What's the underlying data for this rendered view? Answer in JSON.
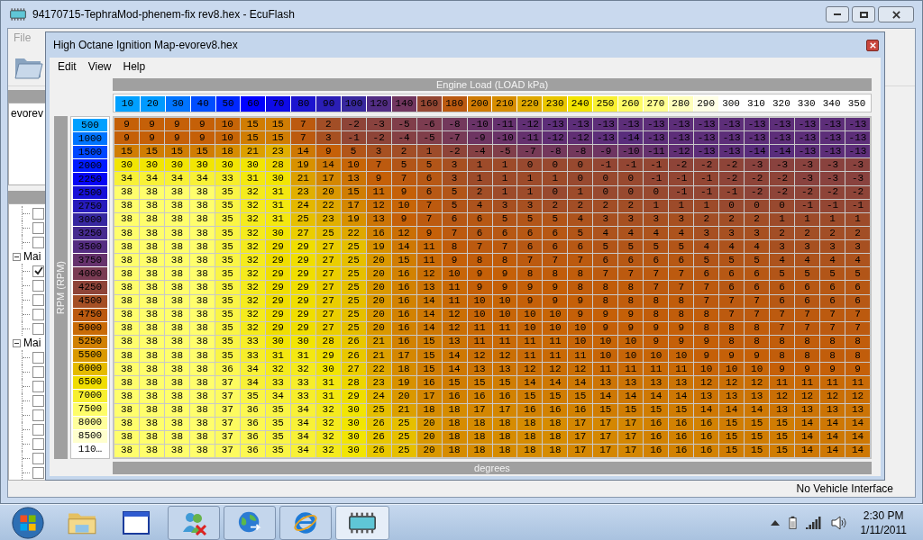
{
  "app_window": {
    "title": "94170715-TephraMod-phenem-fix rev8.hex - EcuFlash",
    "menu": [
      "File"
    ],
    "file_list": [
      "evorev"
    ],
    "tree": {
      "items": [
        {
          "checked": false
        },
        {
          "checked": false
        },
        {
          "checked": false
        }
      ],
      "groups": [
        {
          "label": "Mai",
          "expanded": true,
          "children": [
            {
              "checked": true
            },
            {
              "checked": false
            },
            {
              "checked": false
            },
            {
              "checked": false
            },
            {
              "checked": false
            }
          ]
        },
        {
          "label": "Mai",
          "expanded": true,
          "children": [
            {
              "checked": false
            },
            {
              "checked": false
            },
            {
              "checked": false
            },
            {
              "checked": false
            },
            {
              "checked": false
            },
            {
              "checked": false
            },
            {
              "checked": false
            },
            {
              "checked": false
            },
            {
              "checked": false
            }
          ]
        }
      ]
    },
    "status": "No Vehicle Interface"
  },
  "map_window": {
    "title": "High Octane Ignition Map-evorev8.hex",
    "menu": [
      "Edit",
      "View",
      "Help"
    ],
    "x_axis": {
      "title": "Engine Load (LOAD kPa)",
      "values": [
        "10",
        "20",
        "30",
        "40",
        "50",
        "60",
        "70",
        "80",
        "90",
        "100",
        "120",
        "140",
        "160",
        "180",
        "200",
        "210",
        "220",
        "230",
        "240",
        "250",
        "260",
        "270",
        "280",
        "290",
        "300",
        "310",
        "320",
        "330",
        "340",
        "350"
      ]
    },
    "y_axis": {
      "title": "RPM (RPM)",
      "values": [
        "500",
        "1000",
        "1500",
        "2000",
        "2250",
        "2500",
        "2750",
        "3000",
        "3250",
        "3500",
        "3750",
        "4000",
        "4250",
        "4500",
        "4750",
        "5000",
        "5250",
        "5500",
        "6000",
        "6500",
        "7000",
        "7500",
        "8000",
        "8500",
        "110…"
      ]
    },
    "rows": [
      [
        "9",
        "9",
        "9",
        "9",
        "10",
        "15",
        "15",
        "7",
        "2",
        "-2",
        "-3",
        "-5",
        "-6",
        "-8",
        "-10",
        "-11",
        "-12",
        "-13",
        "-13",
        "-13",
        "-13",
        "-13",
        "-13",
        "-13",
        "-13",
        "-13",
        "-13",
        "-13",
        "-13",
        "-13"
      ],
      [
        "9",
        "9",
        "9",
        "9",
        "10",
        "15",
        "15",
        "7",
        "3",
        "-1",
        "-2",
        "-4",
        "-5",
        "-7",
        "-9",
        "-10",
        "-11",
        "-12",
        "-12",
        "-13",
        "-14",
        "-13",
        "-13",
        "-13",
        "-13",
        "-13",
        "-13",
        "-13",
        "-13",
        "-13"
      ],
      [
        "15",
        "15",
        "15",
        "15",
        "18",
        "21",
        "23",
        "14",
        "9",
        "5",
        "3",
        "2",
        "1",
        "-2",
        "-4",
        "-5",
        "-7",
        "-8",
        "-8",
        "-9",
        "-10",
        "-11",
        "-12",
        "-13",
        "-13",
        "-14",
        "-14",
        "-13",
        "-13",
        "-13"
      ],
      [
        "30",
        "30",
        "30",
        "30",
        "30",
        "30",
        "28",
        "19",
        "14",
        "10",
        "7",
        "5",
        "5",
        "3",
        "1",
        "1",
        "0",
        "0",
        "0",
        "-1",
        "-1",
        "-1",
        "-2",
        "-2",
        "-2",
        "-3",
        "-3",
        "-3",
        "-3",
        "-3"
      ],
      [
        "34",
        "34",
        "34",
        "34",
        "33",
        "31",
        "30",
        "21",
        "17",
        "13",
        "9",
        "7",
        "6",
        "3",
        "1",
        "1",
        "1",
        "1",
        "0",
        "0",
        "0",
        "-1",
        "-1",
        "-1",
        "-2",
        "-2",
        "-2",
        "-3",
        "-3",
        "-3"
      ],
      [
        "38",
        "38",
        "38",
        "38",
        "35",
        "32",
        "31",
        "23",
        "20",
        "15",
        "11",
        "9",
        "6",
        "5",
        "2",
        "1",
        "1",
        "0",
        "1",
        "0",
        "0",
        "0",
        "-1",
        "-1",
        "-1",
        "-2",
        "-2",
        "-2",
        "-2",
        "-2"
      ],
      [
        "38",
        "38",
        "38",
        "38",
        "35",
        "32",
        "31",
        "24",
        "22",
        "17",
        "12",
        "10",
        "7",
        "5",
        "4",
        "3",
        "3",
        "2",
        "2",
        "2",
        "2",
        "1",
        "1",
        "1",
        "0",
        "0",
        "0",
        "-1",
        "-1",
        "-1"
      ],
      [
        "38",
        "38",
        "38",
        "38",
        "35",
        "32",
        "31",
        "25",
        "23",
        "19",
        "13",
        "9",
        "7",
        "6",
        "6",
        "5",
        "5",
        "5",
        "4",
        "3",
        "3",
        "3",
        "3",
        "2",
        "2",
        "2",
        "1",
        "1",
        "1",
        "1"
      ],
      [
        "38",
        "38",
        "38",
        "38",
        "35",
        "32",
        "30",
        "27",
        "25",
        "22",
        "16",
        "12",
        "9",
        "7",
        "6",
        "6",
        "6",
        "6",
        "5",
        "4",
        "4",
        "4",
        "4",
        "3",
        "3",
        "3",
        "2",
        "2",
        "2",
        "2"
      ],
      [
        "38",
        "38",
        "38",
        "38",
        "35",
        "32",
        "29",
        "29",
        "27",
        "25",
        "19",
        "14",
        "11",
        "8",
        "7",
        "7",
        "6",
        "6",
        "6",
        "5",
        "5",
        "5",
        "5",
        "4",
        "4",
        "4",
        "3",
        "3",
        "3",
        "3"
      ],
      [
        "38",
        "38",
        "38",
        "38",
        "35",
        "32",
        "29",
        "29",
        "27",
        "25",
        "20",
        "15",
        "11",
        "9",
        "8",
        "8",
        "7",
        "7",
        "7",
        "6",
        "6",
        "6",
        "6",
        "5",
        "5",
        "5",
        "4",
        "4",
        "4",
        "4"
      ],
      [
        "38",
        "38",
        "38",
        "38",
        "35",
        "32",
        "29",
        "29",
        "27",
        "25",
        "20",
        "16",
        "12",
        "10",
        "9",
        "9",
        "8",
        "8",
        "8",
        "7",
        "7",
        "7",
        "7",
        "6",
        "6",
        "6",
        "5",
        "5",
        "5",
        "5"
      ],
      [
        "38",
        "38",
        "38",
        "38",
        "35",
        "32",
        "29",
        "29",
        "27",
        "25",
        "20",
        "16",
        "13",
        "11",
        "9",
        "9",
        "9",
        "9",
        "8",
        "8",
        "8",
        "7",
        "7",
        "7",
        "6",
        "6",
        "6",
        "6",
        "6",
        "6"
      ],
      [
        "38",
        "38",
        "38",
        "38",
        "35",
        "32",
        "29",
        "29",
        "27",
        "25",
        "20",
        "16",
        "14",
        "11",
        "10",
        "10",
        "9",
        "9",
        "9",
        "8",
        "8",
        "8",
        "8",
        "7",
        "7",
        "7",
        "6",
        "6",
        "6",
        "6"
      ],
      [
        "38",
        "38",
        "38",
        "38",
        "35",
        "32",
        "29",
        "29",
        "27",
        "25",
        "20",
        "16",
        "14",
        "12",
        "10",
        "10",
        "10",
        "10",
        "9",
        "9",
        "9",
        "8",
        "8",
        "8",
        "7",
        "7",
        "7",
        "7",
        "7",
        "7"
      ],
      [
        "38",
        "38",
        "38",
        "38",
        "35",
        "32",
        "29",
        "29",
        "27",
        "25",
        "20",
        "16",
        "14",
        "12",
        "11",
        "11",
        "10",
        "10",
        "10",
        "9",
        "9",
        "9",
        "9",
        "8",
        "8",
        "8",
        "7",
        "7",
        "7",
        "7"
      ],
      [
        "38",
        "38",
        "38",
        "38",
        "35",
        "33",
        "30",
        "30",
        "28",
        "26",
        "21",
        "16",
        "15",
        "13",
        "11",
        "11",
        "11",
        "11",
        "10",
        "10",
        "10",
        "9",
        "9",
        "9",
        "8",
        "8",
        "8",
        "8",
        "8",
        "8"
      ],
      [
        "38",
        "38",
        "38",
        "38",
        "35",
        "33",
        "31",
        "31",
        "29",
        "26",
        "21",
        "17",
        "15",
        "14",
        "12",
        "12",
        "11",
        "11",
        "11",
        "10",
        "10",
        "10",
        "10",
        "9",
        "9",
        "9",
        "8",
        "8",
        "8",
        "8"
      ],
      [
        "38",
        "38",
        "38",
        "38",
        "36",
        "34",
        "32",
        "32",
        "30",
        "27",
        "22",
        "18",
        "15",
        "14",
        "13",
        "13",
        "12",
        "12",
        "12",
        "11",
        "11",
        "11",
        "11",
        "10",
        "10",
        "10",
        "9",
        "9",
        "9",
        "9"
      ],
      [
        "38",
        "38",
        "38",
        "38",
        "37",
        "34",
        "33",
        "33",
        "31",
        "28",
        "23",
        "19",
        "16",
        "15",
        "15",
        "15",
        "14",
        "14",
        "14",
        "13",
        "13",
        "13",
        "13",
        "12",
        "12",
        "12",
        "11",
        "11",
        "11",
        "11"
      ],
      [
        "38",
        "38",
        "38",
        "38",
        "37",
        "35",
        "34",
        "33",
        "31",
        "29",
        "24",
        "20",
        "17",
        "16",
        "16",
        "16",
        "15",
        "15",
        "15",
        "14",
        "14",
        "14",
        "14",
        "13",
        "13",
        "13",
        "12",
        "12",
        "12",
        "12"
      ],
      [
        "38",
        "38",
        "38",
        "38",
        "37",
        "36",
        "35",
        "34",
        "32",
        "30",
        "25",
        "21",
        "18",
        "18",
        "17",
        "17",
        "16",
        "16",
        "16",
        "15",
        "15",
        "15",
        "15",
        "14",
        "14",
        "14",
        "13",
        "13",
        "13",
        "13"
      ],
      [
        "38",
        "38",
        "38",
        "38",
        "37",
        "36",
        "35",
        "34",
        "32",
        "30",
        "26",
        "25",
        "20",
        "18",
        "18",
        "18",
        "18",
        "18",
        "17",
        "17",
        "17",
        "16",
        "16",
        "16",
        "15",
        "15",
        "15",
        "14",
        "14",
        "14"
      ],
      [
        "38",
        "38",
        "38",
        "38",
        "37",
        "36",
        "35",
        "34",
        "32",
        "30",
        "26",
        "25",
        "20",
        "18",
        "18",
        "18",
        "18",
        "18",
        "17",
        "17",
        "17",
        "16",
        "16",
        "16",
        "15",
        "15",
        "15",
        "14",
        "14",
        "14"
      ],
      [
        "38",
        "38",
        "38",
        "38",
        "37",
        "36",
        "35",
        "34",
        "32",
        "30",
        "26",
        "25",
        "20",
        "18",
        "18",
        "18",
        "18",
        "18",
        "17",
        "17",
        "17",
        "16",
        "16",
        "16",
        "15",
        "15",
        "15",
        "14",
        "14",
        "14"
      ]
    ],
    "units": "degrees"
  },
  "taskbar": {
    "time": "2:30 PM",
    "date": "1/11/2011"
  }
}
